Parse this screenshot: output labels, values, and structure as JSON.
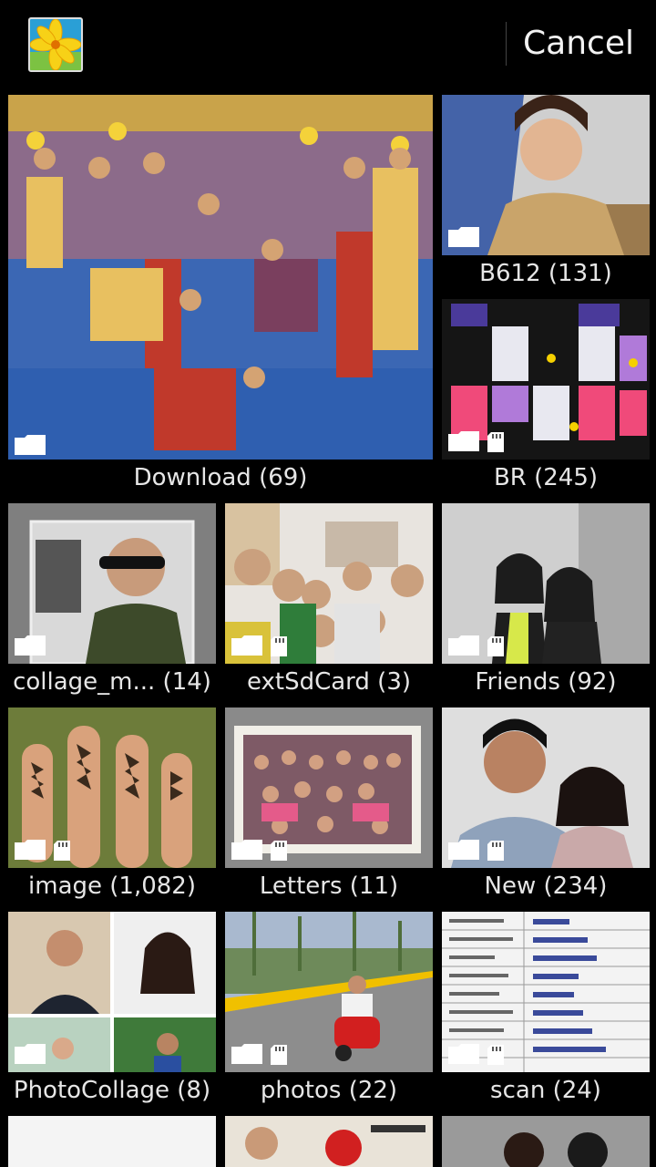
{
  "header": {
    "cancel_label": "Cancel",
    "app_icon": "gallery-flower-icon"
  },
  "albums": [
    {
      "label": "Download (69)",
      "badges": [
        "folder"
      ]
    },
    {
      "label": "B612 (131)",
      "badges": [
        "folder"
      ]
    },
    {
      "label": "BR (245)",
      "badges": [
        "folder",
        "sdcard"
      ]
    },
    {
      "label": "collage_m... (14)",
      "badges": [
        "folder"
      ]
    },
    {
      "label": "extSdCard (3)",
      "badges": [
        "folder",
        "sdcard"
      ]
    },
    {
      "label": "Friends (92)",
      "badges": [
        "folder",
        "sdcard"
      ]
    },
    {
      "label": "image (1,082)",
      "badges": [
        "folder",
        "sdcard"
      ]
    },
    {
      "label": "Letters (11)",
      "badges": [
        "folder",
        "sdcard"
      ]
    },
    {
      "label": "New (234)",
      "badges": [
        "folder",
        "sdcard"
      ]
    },
    {
      "label": "PhotoCollage (8)",
      "badges": [
        "folder"
      ]
    },
    {
      "label": "photos (22)",
      "badges": [
        "folder",
        "sdcard"
      ]
    },
    {
      "label": "scan (24)",
      "badges": [
        "folder",
        "sdcard"
      ]
    }
  ],
  "colors": {
    "background": "#000000",
    "label": "#e6e6e6"
  }
}
